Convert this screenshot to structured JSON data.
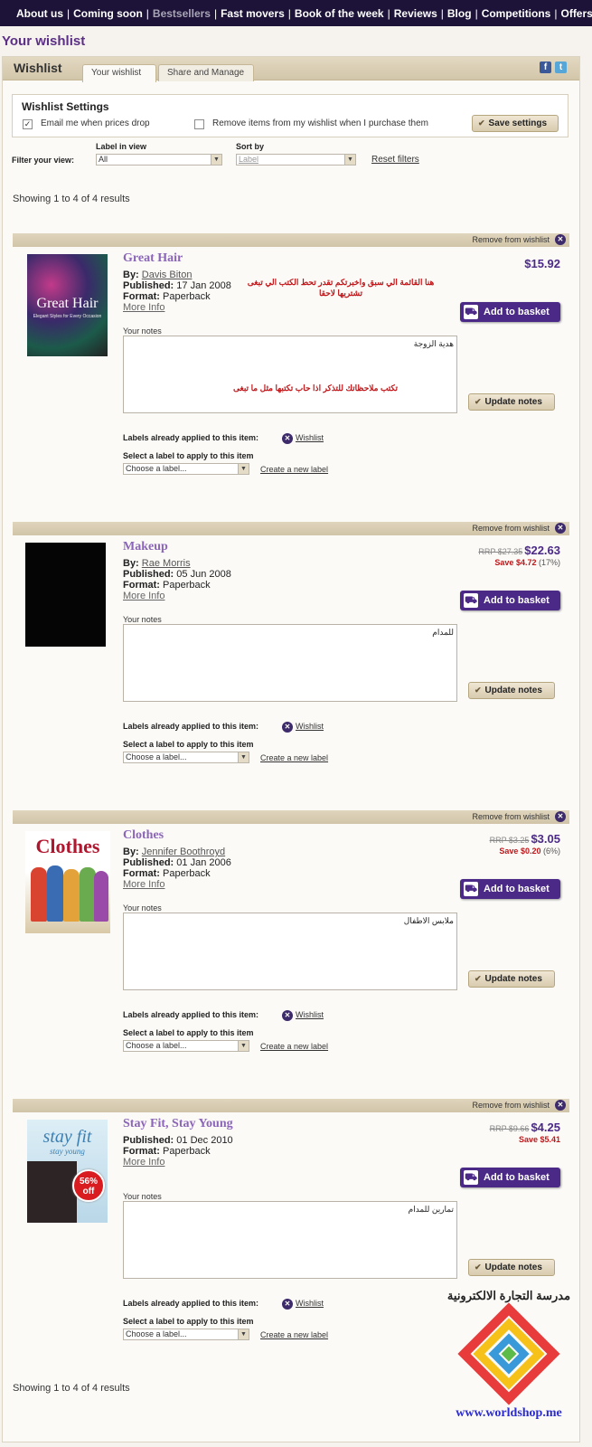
{
  "nav": [
    "About us",
    "Coming soon",
    "Bestsellers",
    "Fast movers",
    "Book of the week",
    "Reviews",
    "Blog",
    "Competitions",
    "Offers"
  ],
  "page_title": "Your wishlist",
  "panel": {
    "title": "Wishlist",
    "tabs": [
      "Your wishlist",
      "Share and Manage"
    ],
    "social": [
      "facebook-icon",
      "twitter-icon"
    ]
  },
  "settings": {
    "title": "Wishlist Settings",
    "email_label": "Email me when prices drop",
    "remove_label": "Remove items from my wishlist when I purchase them",
    "save_button": "Save settings"
  },
  "filters": {
    "prefix": "Filter your view:",
    "label_in_view": "Label in view",
    "label_value": "All",
    "sort_by": "Sort by",
    "sort_value": "Label",
    "reset": "Reset filters"
  },
  "showing": "Showing 1 to 4 of 4 results",
  "common": {
    "remove": "Remove from wishlist",
    "add_to_basket": "Add to basket",
    "your_notes": "Your notes",
    "update_notes": "Update notes",
    "labels_applied": "Labels already applied to this item:",
    "wishlist_label": "Wishlist",
    "select_label": "Select a label to apply to this item",
    "choose_placeholder": "Choose a label...",
    "create_label": "Create a new label",
    "by": "By:",
    "published": "Published:",
    "format": "Format:",
    "more_info": "More Info"
  },
  "items": [
    {
      "title": "Great Hair",
      "author": "Davis Biton",
      "published": "17 Jan 2008",
      "format": "Paperback",
      "price": "$15.92",
      "note": "هدية الزوجة",
      "annotation_top": "هنا القائمة الي سبق واخبرتكم تقدر تحط الكتب الي تبغى تشتريها لاحقا",
      "annotation_notes": "تكتب ملاحظاتك للتذكر اذا حاب تكتبها مثل ما تبغى",
      "cover_title": "Great Hair",
      "cover_sub": "Elegant Styles for Every Occasion"
    },
    {
      "title": "Makeup",
      "author": "Rae Morris",
      "published": "05 Jun 2008",
      "format": "Paperback",
      "rrp": "RRP $27.35",
      "price": "$22.63",
      "save": "Save $4.72",
      "save_pct": "(17%)",
      "note": "للمدام"
    },
    {
      "title": "Clothes",
      "author": "Jennifer Boothroyd",
      "published": "01 Jan 2006",
      "format": "Paperback",
      "rrp": "RRP $3.25",
      "price": "$3.05",
      "save": "Save $0.20",
      "save_pct": "(6%)",
      "note": "ملابس الاطفال",
      "cover_title": "Clothes"
    },
    {
      "title": "Stay Fit, Stay Young",
      "published": "01 Dec 2010",
      "format": "Paperback",
      "rrp": "RRP $9.66",
      "price": "$4.25",
      "save": "Save $5.41",
      "note": "تمارين للمدام",
      "badge": "56% off",
      "cover_title": "stay fit",
      "cover_sub": "stay young"
    }
  ],
  "logo": {
    "arabic": "مدرسة التجارة الالكترونية",
    "url": "www.worldshop.me"
  }
}
